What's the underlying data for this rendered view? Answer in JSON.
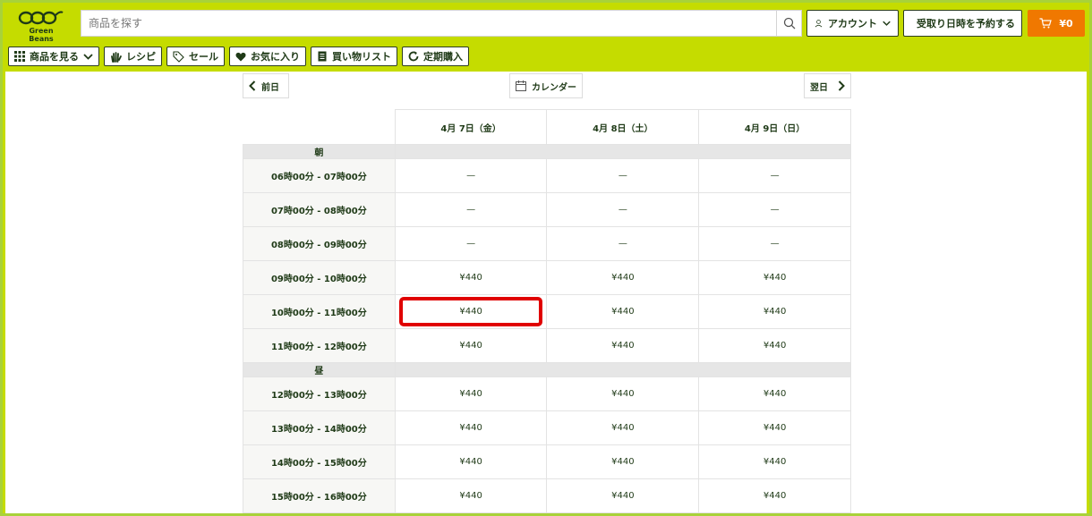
{
  "brand": {
    "name": "Green Beans",
    "color": "#c5dc00",
    "accent": "#1f3a17"
  },
  "search": {
    "placeholder": "商品を探す"
  },
  "header": {
    "account_label": "アカウント",
    "reserve_label": "受取り日時を予約する",
    "cart_label": "¥0",
    "cart_color": "#f07800"
  },
  "nav": {
    "items": [
      {
        "label": "商品を見る",
        "icon": "grid-icon"
      },
      {
        "label": "レシピ",
        "icon": "hand-icon"
      },
      {
        "label": "セール",
        "icon": "tag-icon"
      },
      {
        "label": "お気に入り",
        "icon": "heart-icon"
      },
      {
        "label": "買い物リスト",
        "icon": "list-icon"
      },
      {
        "label": "定期購入",
        "icon": "refresh-icon"
      }
    ]
  },
  "schedule": {
    "prev_label": "前日",
    "calendar_label": "カレンダー",
    "next_label": "翌日",
    "dates": [
      "4月 7日（金）",
      "4月 8日（土）",
      "4月 9日（日）"
    ],
    "sections": [
      {
        "label": "朝",
        "rows": [
          {
            "slot": "06時00分 - 07時00分",
            "cells": [
              "—",
              "—",
              "—"
            ]
          },
          {
            "slot": "07時00分 - 08時00分",
            "cells": [
              "—",
              "—",
              "—"
            ]
          },
          {
            "slot": "08時00分 - 09時00分",
            "cells": [
              "—",
              "—",
              "—"
            ]
          },
          {
            "slot": "09時00分 - 10時00分",
            "cells": [
              "¥440",
              "¥440",
              "¥440"
            ]
          },
          {
            "slot": "10時00分 - 11時00分",
            "cells": [
              "¥440",
              "¥440",
              "¥440"
            ]
          },
          {
            "slot": "11時00分 - 12時00分",
            "cells": [
              "¥440",
              "¥440",
              "¥440"
            ]
          }
        ]
      },
      {
        "label": "昼",
        "rows": [
          {
            "slot": "12時00分 - 13時00分",
            "cells": [
              "¥440",
              "¥440",
              "¥440"
            ]
          },
          {
            "slot": "13時00分 - 14時00分",
            "cells": [
              "¥440",
              "¥440",
              "¥440"
            ]
          },
          {
            "slot": "14時00分 - 15時00分",
            "cells": [
              "¥440",
              "¥440",
              "¥440"
            ]
          },
          {
            "slot": "15時00分 - 16時00分",
            "cells": [
              "¥440",
              "¥440",
              "¥440"
            ]
          }
        ]
      }
    ],
    "highlight_color": "#e00000"
  }
}
